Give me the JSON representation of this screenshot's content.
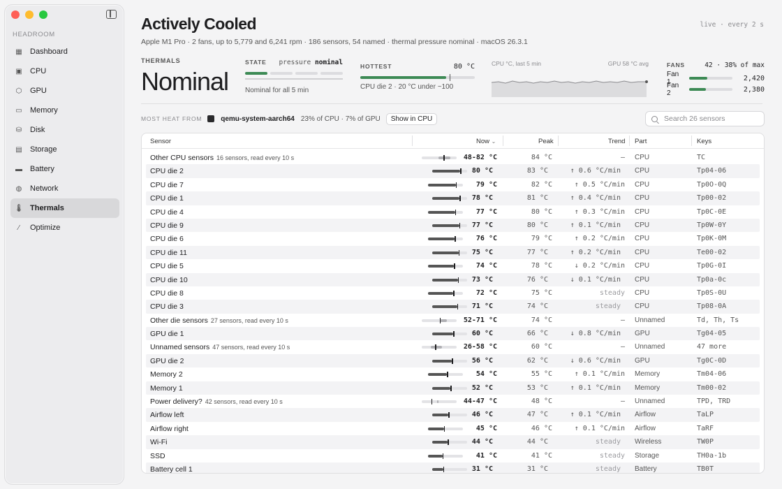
{
  "sidebar": {
    "section": "HEADROOM",
    "items": [
      {
        "label": "Dashboard",
        "icon": "grid-icon"
      },
      {
        "label": "CPU",
        "icon": "cpu-icon"
      },
      {
        "label": "GPU",
        "icon": "cube-icon"
      },
      {
        "label": "Memory",
        "icon": "memory-icon"
      },
      {
        "label": "Disk",
        "icon": "disk-icon"
      },
      {
        "label": "Storage",
        "icon": "storage-icon"
      },
      {
        "label": "Battery",
        "icon": "battery-icon"
      },
      {
        "label": "Network",
        "icon": "globe-icon"
      },
      {
        "label": "Thermals",
        "icon": "thermometer-icon",
        "active": true
      },
      {
        "label": "Optimize",
        "icon": "wand-icon"
      }
    ]
  },
  "header": {
    "title": "Actively Cooled",
    "subtitle": "Apple M1 Pro · 2 fans, up to 5,779 and 6,241 rpm · 186 sensors, 54 named · thermal pressure nominal · macOS 26.3.1",
    "live": "live · every 2 s"
  },
  "thermals": {
    "label": "THERMALS",
    "status": "Nominal"
  },
  "state": {
    "label": "STATE",
    "pressure_key": "pressure",
    "pressure_val": "nominal",
    "segments_on": 1,
    "segments_total": 4,
    "note": "Nominal for all 5 min"
  },
  "hottest": {
    "label": "HOTTEST",
    "value": "80 °C",
    "fill_fraction": 0.75,
    "limit_fraction": 0.78,
    "note": "CPU die 2 · 20 °C under ~100"
  },
  "graph": {
    "left_label": "CPU °C, last 5 min",
    "right_label": "GPU 58 °C avg"
  },
  "fans": {
    "label": "FANS",
    "summary": "42 · 38% of max",
    "items": [
      {
        "name": "Fan 1",
        "rpm": "2,420",
        "fraction": 0.42
      },
      {
        "name": "Fan 2",
        "rpm": "2,380",
        "fraction": 0.38
      }
    ]
  },
  "heat": {
    "label": "MOST HEAT FROM",
    "process": "qemu-system-aarch64",
    "share": "23% of CPU · 7% of GPU",
    "button": "Show in CPU"
  },
  "search": {
    "placeholder": "Search 26 sensors"
  },
  "table": {
    "columns": {
      "sensor": "Sensor",
      "now": "Now",
      "peak": "Peak",
      "trend": "Trend",
      "part": "Part",
      "keys": "Keys"
    },
    "rows": [
      {
        "sensor": "Other CPU sensors",
        "sub": "16 sensors, read every 10 s",
        "now": "48-82",
        "unit": "°C",
        "peak": "84",
        "trend": "–",
        "part": "CPU",
        "keys": "TC",
        "lo": 0.48,
        "hi": 0.82,
        "group": true
      },
      {
        "sensor": "CPU die 2",
        "now": "80",
        "unit": "°C",
        "peak": "83",
        "trend": "↑ 0.6 °C/min",
        "part": "CPU",
        "keys": "Tp04-06",
        "v": 0.8
      },
      {
        "sensor": "CPU die 7",
        "now": "79",
        "unit": "°C",
        "peak": "82",
        "trend": "↑ 0.5 °C/min",
        "part": "CPU",
        "keys": "Tp0O-0Q",
        "v": 0.79
      },
      {
        "sensor": "CPU die 1",
        "now": "78",
        "unit": "°C",
        "peak": "81",
        "trend": "↑ 0.4 °C/min",
        "part": "CPU",
        "keys": "Tp00-02",
        "v": 0.78
      },
      {
        "sensor": "CPU die 4",
        "now": "77",
        "unit": "°C",
        "peak": "80",
        "trend": "↑ 0.3 °C/min",
        "part": "CPU",
        "keys": "Tp0C-0E",
        "v": 0.77
      },
      {
        "sensor": "CPU die 9",
        "now": "77",
        "unit": "°C",
        "peak": "80",
        "trend": "↑ 0.1 °C/min",
        "part": "CPU",
        "keys": "Tp0W-0Y",
        "v": 0.77
      },
      {
        "sensor": "CPU die 6",
        "now": "76",
        "unit": "°C",
        "peak": "79",
        "trend": "↑ 0.2 °C/min",
        "part": "CPU",
        "keys": "Tp0K-0M",
        "v": 0.76
      },
      {
        "sensor": "CPU die 11",
        "now": "75",
        "unit": "°C",
        "peak": "77",
        "trend": "↑ 0.2 °C/min",
        "part": "CPU",
        "keys": "Te00-02",
        "v": 0.75
      },
      {
        "sensor": "CPU die 5",
        "now": "74",
        "unit": "°C",
        "peak": "78",
        "trend": "↓ 0.2 °C/min",
        "part": "CPU",
        "keys": "Tp0G-0I",
        "v": 0.74
      },
      {
        "sensor": "CPU die 10",
        "now": "73",
        "unit": "°C",
        "peak": "76",
        "trend": "↓ 0.1 °C/min",
        "part": "CPU",
        "keys": "Tp0a-0c",
        "v": 0.73
      },
      {
        "sensor": "CPU die 8",
        "now": "72",
        "unit": "°C",
        "peak": "75",
        "trend": "steady",
        "part": "CPU",
        "keys": "Tp0S-0U",
        "v": 0.72
      },
      {
        "sensor": "CPU die 3",
        "now": "71",
        "unit": "°C",
        "peak": "74",
        "trend": "steady",
        "part": "CPU",
        "keys": "Tp08-0A",
        "v": 0.71
      },
      {
        "sensor": "Other die sensors",
        "sub": "27 sensors, read every 10 s",
        "now": "52-71",
        "unit": "°C",
        "peak": "74",
        "trend": "–",
        "part": "Unnamed",
        "keys": "Td, Th, Ts",
        "lo": 0.52,
        "hi": 0.71,
        "group": true
      },
      {
        "sensor": "GPU die 1",
        "now": "60",
        "unit": "°C",
        "peak": "66",
        "trend": "↓ 0.8 °C/min",
        "part": "GPU",
        "keys": "Tg04-05",
        "v": 0.6
      },
      {
        "sensor": "Unnamed sensors",
        "sub": "47 sensors, read every 10 s",
        "now": "26-58",
        "unit": "°C",
        "peak": "60",
        "trend": "–",
        "part": "Unnamed",
        "keys": "47 more",
        "lo": 0.26,
        "hi": 0.58,
        "group": true
      },
      {
        "sensor": "GPU die 2",
        "now": "56",
        "unit": "°C",
        "peak": "62",
        "trend": "↓ 0.6 °C/min",
        "part": "GPU",
        "keys": "Tg0C-0D",
        "v": 0.56
      },
      {
        "sensor": "Memory 2",
        "now": "54",
        "unit": "°C",
        "peak": "55",
        "trend": "↑ 0.1 °C/min",
        "part": "Memory",
        "keys": "Tm04-06",
        "v": 0.54
      },
      {
        "sensor": "Memory 1",
        "now": "52",
        "unit": "°C",
        "peak": "53",
        "trend": "↑ 0.1 °C/min",
        "part": "Memory",
        "keys": "Tm00-02",
        "v": 0.52
      },
      {
        "sensor": "Power delivery?",
        "sub": "42 sensors, read every 10 s",
        "now": "44-47",
        "unit": "°C",
        "peak": "48",
        "trend": "–",
        "part": "Unnamed",
        "keys": "TPD, TRD",
        "lo": 0.44,
        "hi": 0.47,
        "group": true
      },
      {
        "sensor": "Airflow left",
        "now": "46",
        "unit": "°C",
        "peak": "47",
        "trend": "↑ 0.1 °C/min",
        "part": "Airflow",
        "keys": "TaLP",
        "v": 0.46
      },
      {
        "sensor": "Airflow right",
        "now": "45",
        "unit": "°C",
        "peak": "46",
        "trend": "↑ 0.1 °C/min",
        "part": "Airflow",
        "keys": "TaRF",
        "v": 0.45
      },
      {
        "sensor": "Wi-Fi",
        "now": "44",
        "unit": "°C",
        "peak": "44",
        "trend": "steady",
        "part": "Wireless",
        "keys": "TW0P",
        "v": 0.44
      },
      {
        "sensor": "SSD",
        "now": "41",
        "unit": "°C",
        "peak": "41",
        "trend": "steady",
        "part": "Storage",
        "keys": "TH0a-1b",
        "v": 0.41
      },
      {
        "sensor": "Battery cell 1",
        "now": "31",
        "unit": "°C",
        "peak": "31",
        "trend": "steady",
        "part": "Battery",
        "keys": "TB0T",
        "v": 0.31
      }
    ]
  },
  "colors": {
    "accent": "#3d8a55",
    "close": "#fe5f57",
    "minimize": "#febc2e",
    "zoom": "#28c840"
  }
}
